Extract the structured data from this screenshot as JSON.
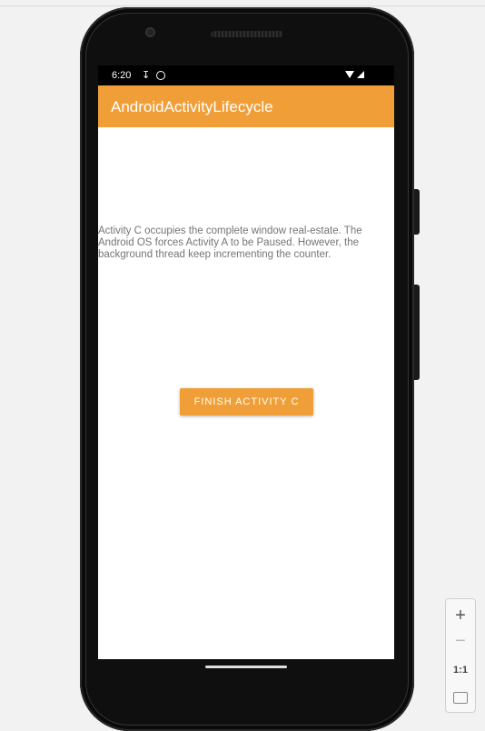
{
  "status_bar": {
    "time": "6:20",
    "left_icons": [
      "download-icon",
      "sync-icon"
    ],
    "right_icons": [
      "wifi-icon",
      "signal-icon"
    ]
  },
  "app_bar": {
    "title": "AndroidActivityLifecycle",
    "color": "#F09F38"
  },
  "content": {
    "description": "Activity C occupies the complete window real-estate. The Android OS forces Activity A to be Paused. However, the background thread keep incrementing the counter.",
    "finish_button_label": "FINISH ACTIVITY C"
  },
  "zoom_controls": {
    "zoom_in": "+",
    "zoom_out": "−",
    "reset": "1:1"
  }
}
